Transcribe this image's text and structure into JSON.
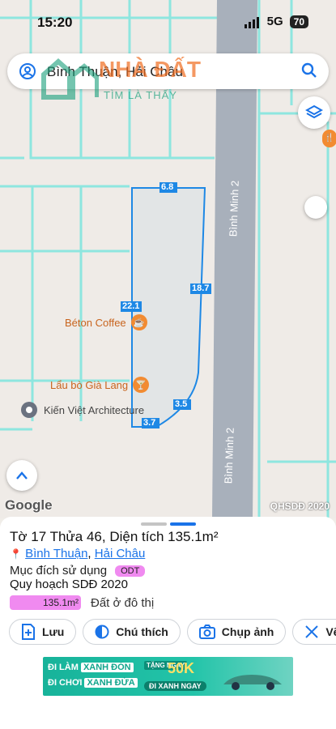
{
  "status": {
    "time": "15:20",
    "network": "5G",
    "battery": "70"
  },
  "search": {
    "query": "Bình Thuận, Hải Châu"
  },
  "watermark": {
    "brand": "NHÀ ĐẤT",
    "tagline": "TÌM LÀ THẤY"
  },
  "map": {
    "road_label_top": "Bình Minh 2",
    "road_label_bottom": "Bình Minh 2",
    "edge_top": "6.8",
    "edge_right": "18.7",
    "edge_left": "22.1",
    "edge_curve": "3.5",
    "edge_bottom": "3.7",
    "poi_cafe": "Béton Coffee",
    "poi_restaurant": "Lẩu bò Già Lang",
    "poi_architecture": "Kiến Việt Architecture",
    "google_logo": "Google",
    "layer_badge": "QHSDĐ 2020",
    "plot_color": "#1e88e5",
    "road_color": "#a8b0bb"
  },
  "parcel": {
    "title": "Tờ 17 Thửa 46, Diện tích 135.1m²",
    "ward": "Bình Thuận",
    "district": "Hải Châu",
    "separator": ",",
    "purpose_label": "Mục đích sử dụng",
    "purpose_code": "ODT",
    "plan_title": "Quy hoạch SDĐ 2020",
    "area_value": "135.1m²",
    "area_description": "Đất ở đô thị",
    "badge_color": "#f08af0"
  },
  "actions": {
    "save": "Lưu",
    "note": "Chú thích",
    "photo": "Chụp ảnh",
    "draw": "Vẽ"
  },
  "ad": {
    "line1_a": "ĐI LÀM",
    "line1_b": "XANH ĐÓN",
    "line2_a": "ĐI CHƠI",
    "line2_b": "XANH ĐỬA",
    "tag": "TẶNG NGAY",
    "amount": "50K",
    "cta": "ĐI XANH NGAY"
  }
}
